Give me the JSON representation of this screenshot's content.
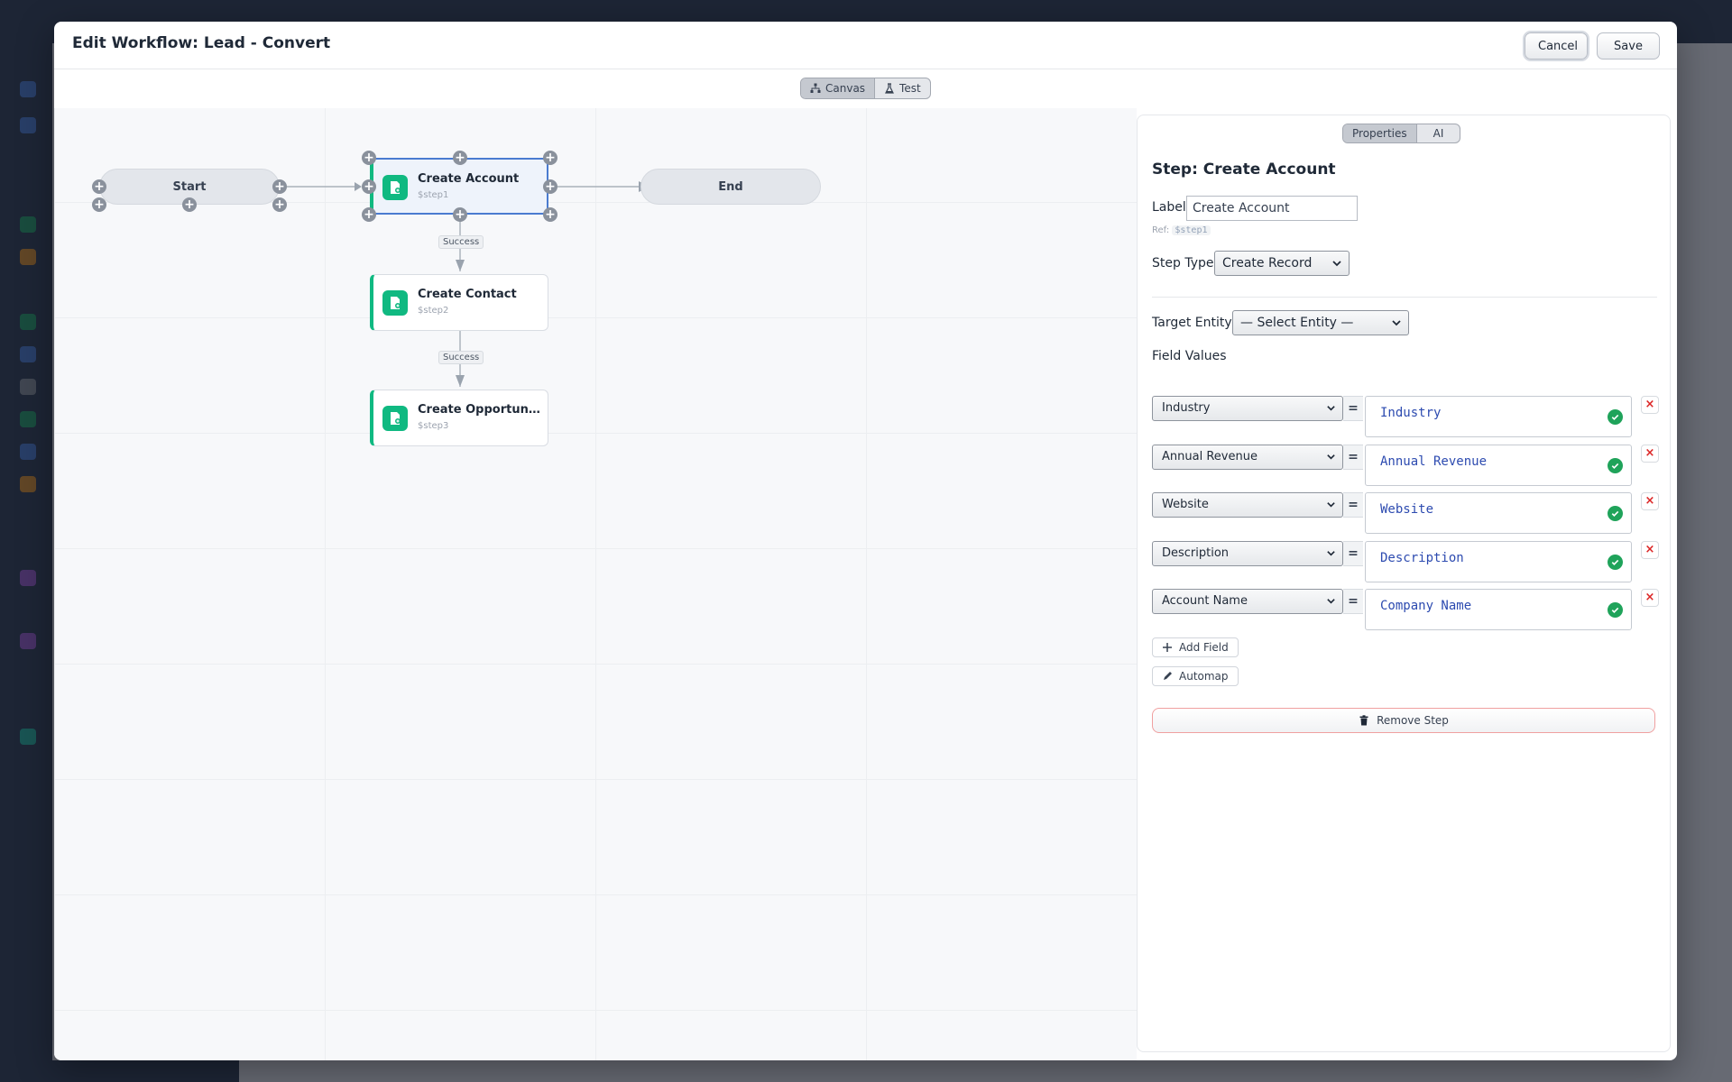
{
  "modal": {
    "title": "Edit Workflow: Lead - Convert",
    "cancel_label": "Cancel",
    "save_label": "Save"
  },
  "mode_toggle": {
    "canvas_label": "Canvas",
    "test_label": "Test",
    "active": "Canvas"
  },
  "canvas": {
    "start_label": "Start",
    "end_label": "End",
    "steps": [
      {
        "title": "Create Account",
        "ref": "$step1",
        "selected": true
      },
      {
        "title": "Create Contact",
        "ref": "$step2",
        "selected": false
      },
      {
        "title": "Create Opportunity",
        "ref": "$step3",
        "selected": false
      }
    ],
    "edge_labels": [
      "Success",
      "Success"
    ]
  },
  "panel": {
    "tabs": [
      "Properties",
      "AI"
    ],
    "active_tab": "Properties",
    "heading": "Step: Create Account",
    "label_caption": "Label",
    "label_value": "Create Account",
    "ref_prefix": "Ref:",
    "ref_value": "$step1",
    "step_type_caption": "Step Type",
    "step_type_value": "Create Record",
    "target_entity_caption": "Target Entity",
    "target_entity_value": "— Select Entity —",
    "field_values_caption": "Field Values",
    "field_values": [
      {
        "field": "Industry",
        "value": "Industry"
      },
      {
        "field": "Annual Revenue",
        "value": "Annual Revenue"
      },
      {
        "field": "Website",
        "value": "Website"
      },
      {
        "field": "Description",
        "value": "Description"
      },
      {
        "field": "Account Name",
        "value": "Company Name"
      }
    ],
    "equals_sign": "=",
    "remove_glyph": "×",
    "add_field_label": "Add Field",
    "automap_label": "Automap",
    "remove_step_label": "Remove Step"
  },
  "colors": {
    "accent_green": "#10b981",
    "selected_border": "#4a7bd0",
    "valid_check": "#1fa35a",
    "danger": "#dc2626",
    "value_text": "#2d4bb0"
  },
  "icons": {
    "canvas": "sitemap-icon",
    "test": "flask-icon",
    "step": "document-plus-icon",
    "valid": "check-circle-icon",
    "add": "plus-icon",
    "automap": "pencil-icon",
    "remove_step": "trash-icon"
  }
}
